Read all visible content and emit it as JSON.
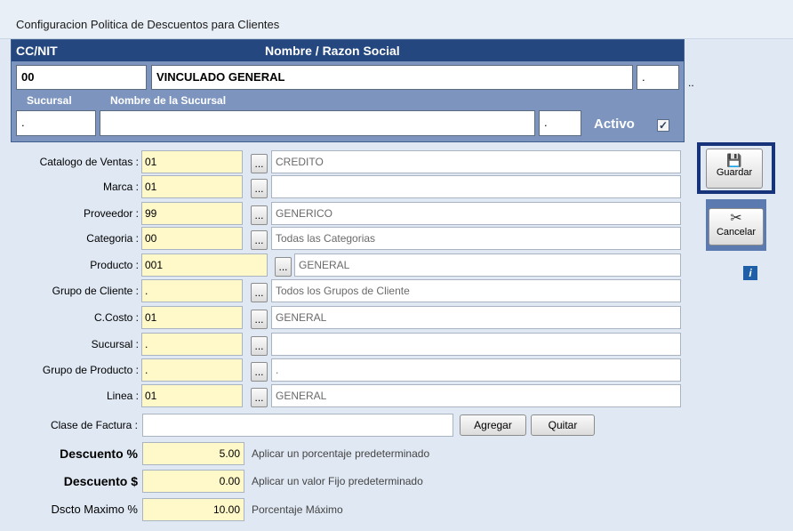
{
  "window": {
    "title": "Configuracion Politica de Descuentos para Clientes"
  },
  "header": {
    "cc_label": "CC/NIT",
    "name_label": "Nombre / Razon Social",
    "cc_value": "00",
    "name_value": "VINCULADO GENERAL",
    "extra_value": ".",
    "side_dots": "..",
    "branch_label": "Sucursal",
    "branch_name_label": "Nombre de la Sucursal",
    "branch_value": ".",
    "branch_name_value": "",
    "branch_extra": ".",
    "active_label": "Activo",
    "active_checked": true
  },
  "form": {
    "rows": [
      {
        "label": "Catalogo de Ventas :",
        "code": "01",
        "desc": "CREDITO"
      },
      {
        "label": "Marca :",
        "code": "01",
        "desc": ""
      },
      {
        "label": "Proveedor :",
        "code": "99",
        "desc": "GENERICO"
      },
      {
        "label": "Categoria :",
        "code": "00",
        "desc": "Todas las Categorias"
      },
      {
        "label": "Producto :",
        "code": "001",
        "desc": "GENERAL"
      },
      {
        "label": "Grupo de Cliente :",
        "code": ".",
        "desc": "Todos los Grupos de Cliente"
      },
      {
        "label": "C.Costo :",
        "code": "01",
        "desc": "GENERAL"
      },
      {
        "label": "Sucursal :",
        "code": ".",
        "desc": ""
      },
      {
        "label": "Grupo de Producto :",
        "code": ".",
        "desc": "."
      },
      {
        "label": "Linea :",
        "code": "01",
        "desc": "GENERAL"
      }
    ],
    "lookup_label": "...",
    "invoice_class_label": "Clase de Factura :",
    "invoice_class_value": "",
    "add_label": "Agregar",
    "remove_label": "Quitar"
  },
  "discounts": [
    {
      "label": "Descuento %",
      "value": "5.00",
      "hint": "Aplicar un porcentaje predeterminado"
    },
    {
      "label": "Descuento $",
      "value": "0.00",
      "hint": "Aplicar un valor Fijo predeterminado"
    },
    {
      "label": "Dscto Maximo %",
      "value": "10.00",
      "hint": "Porcentaje Máximo"
    }
  ],
  "sidebar": {
    "save_label": "Guardar",
    "cancel_label": "Cancelar",
    "info_label": "i"
  }
}
